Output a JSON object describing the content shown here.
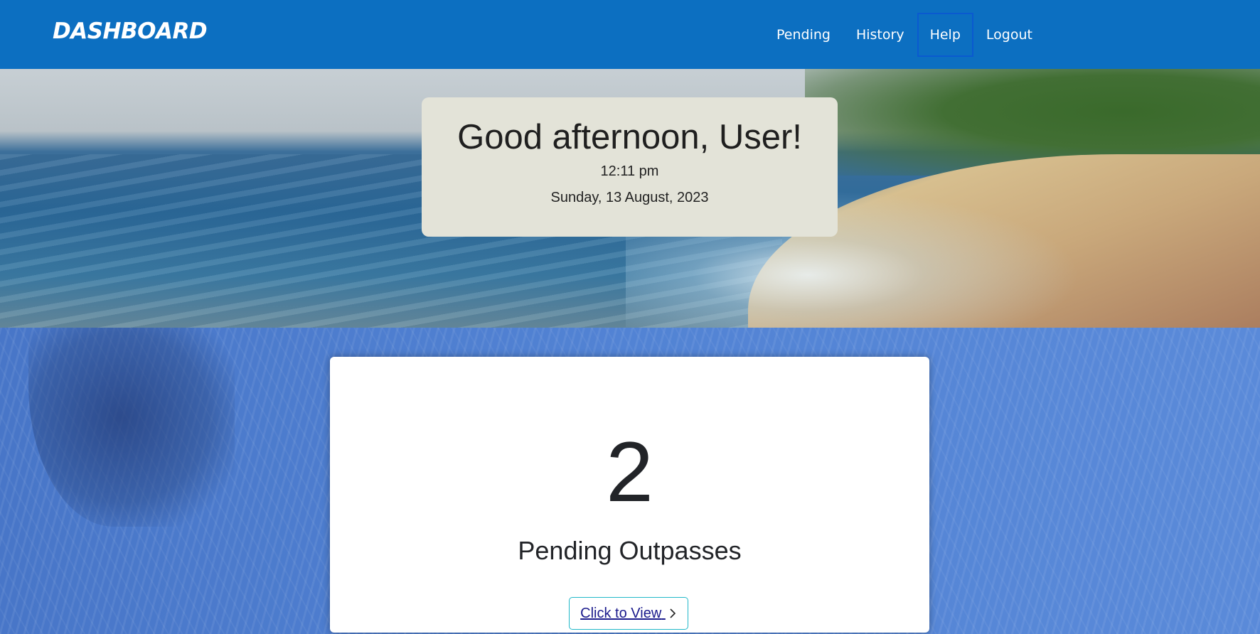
{
  "navbar": {
    "brand": "DASHBOARD",
    "items": [
      {
        "label": "Pending"
      },
      {
        "label": "History"
      },
      {
        "label": "Help"
      },
      {
        "label": "Logout"
      }
    ]
  },
  "greeting_card": {
    "greeting": "Good afternoon, User!",
    "time": "12:11 pm",
    "date": "Sunday, 13 August, 2023"
  },
  "pending_card": {
    "count": "2",
    "label": "Pending Outpasses",
    "button_label": "Click to View",
    "button_icon": "chevron-right-icon"
  }
}
